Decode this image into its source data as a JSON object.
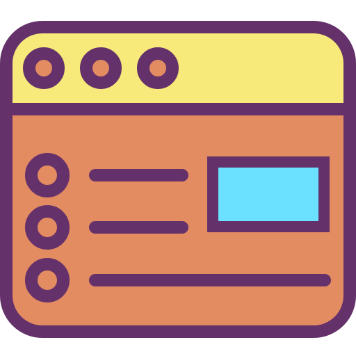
{
  "icon": {
    "name": "browser-window-list-icon",
    "colors": {
      "outline": "#65316B",
      "titlebar": "#F7EA7A",
      "body": "#E38C62",
      "window_buttons": "#E38C62",
      "image_placeholder": "#6CE0FF"
    },
    "titlebar_buttons": [
      "window-dot-1-icon",
      "window-dot-2-icon",
      "window-dot-3-icon"
    ],
    "list_rows": [
      {
        "bullet": "radio-bullet-1-icon",
        "line": "short-text-line"
      },
      {
        "bullet": "radio-bullet-2-icon",
        "line": "short-text-line"
      },
      {
        "bullet": "radio-bullet-3-icon",
        "line": "long-text-line"
      }
    ],
    "image": "image-placeholder-icon"
  }
}
